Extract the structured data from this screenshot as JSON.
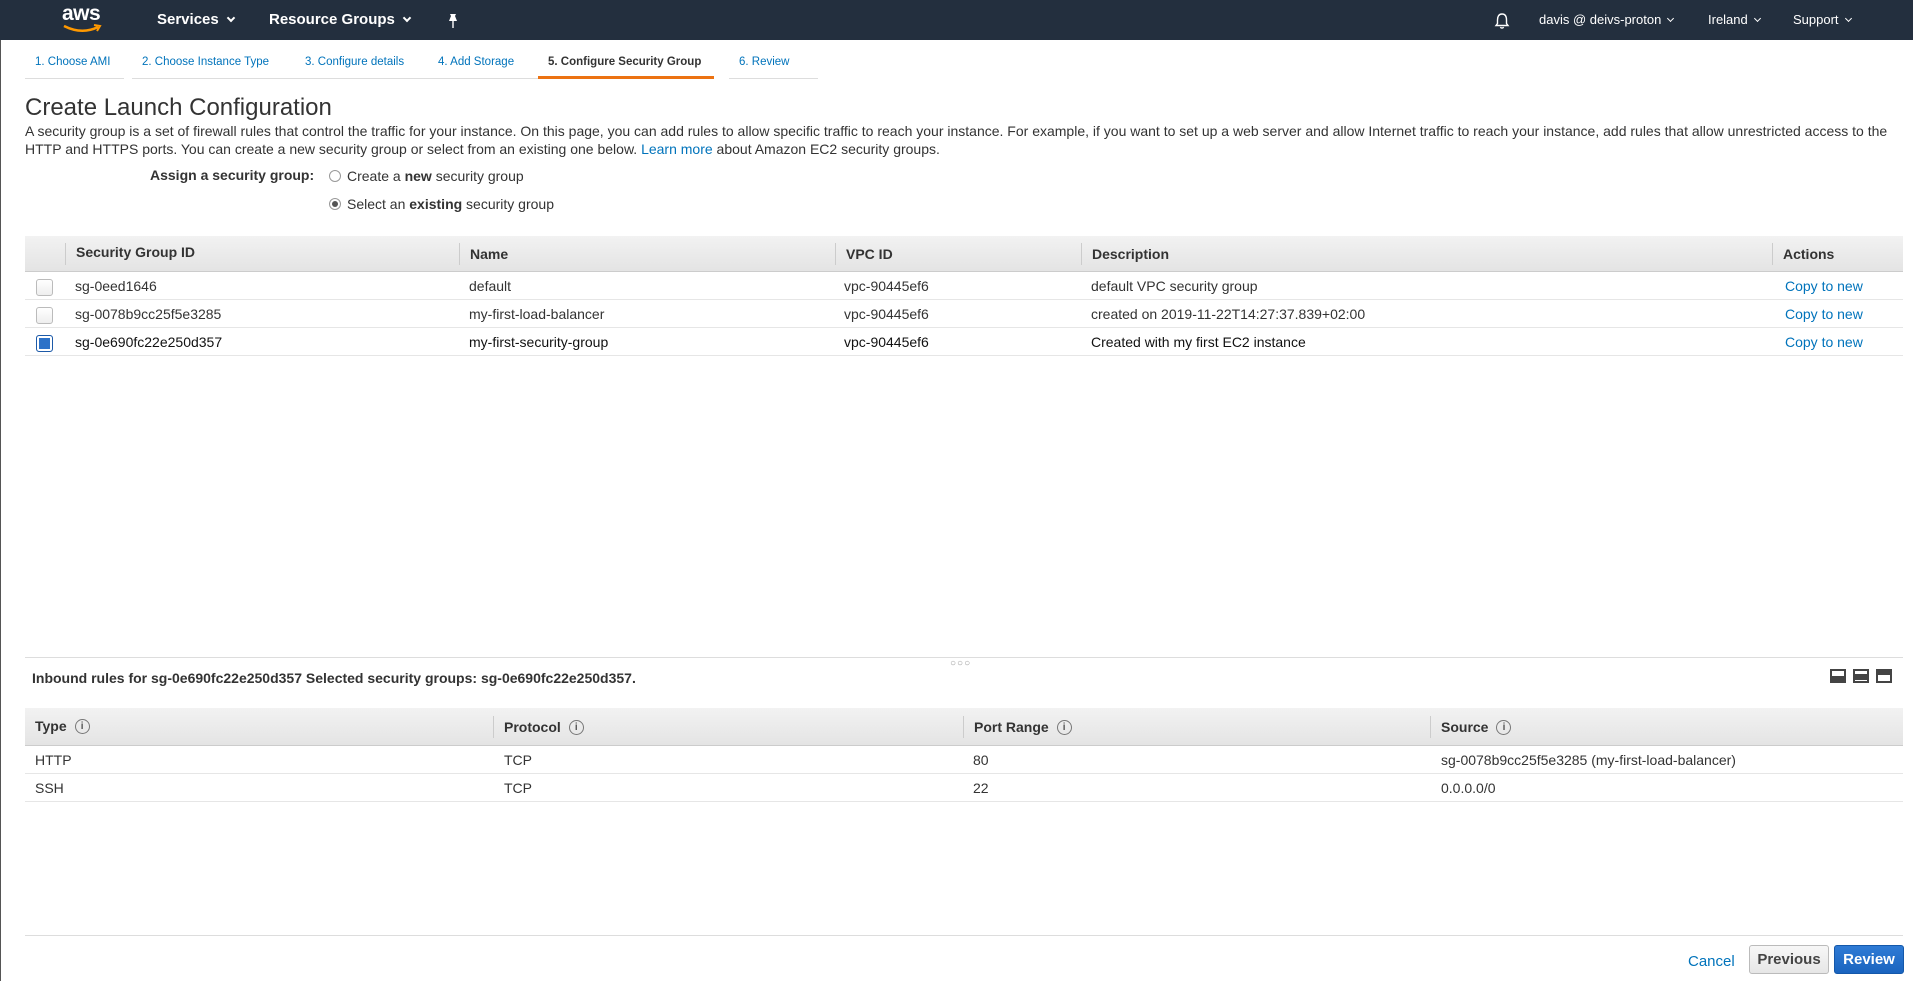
{
  "topnav": {
    "logo": "aws",
    "services": "Services",
    "resource_groups": "Resource Groups",
    "user": "davis @ deivs-proton",
    "region": "Ireland",
    "support": "Support"
  },
  "tabs": [
    {
      "label": "1. Choose AMI"
    },
    {
      "label": "2. Choose Instance Type"
    },
    {
      "label": "3. Configure details"
    },
    {
      "label": "4. Add Storage"
    },
    {
      "label": "5. Configure Security Group"
    },
    {
      "label": "6. Review"
    }
  ],
  "page": {
    "title": "Create Launch Configuration",
    "intro_text": "A security group is a set of firewall rules that control the traffic for your instance. On this page, you can add rules to allow specific traffic to reach your instance. For example, if you want to set up a web server and allow Internet traffic to reach your instance, add rules that allow unrestricted access to the HTTP and HTTPS ports. You can create a new security group or select from an existing one below.",
    "learn_more": "Learn more",
    "intro_tail": "about Amazon EC2 security groups."
  },
  "assign": {
    "label": "Assign a security group:",
    "option_new_pre": "Create a ",
    "option_new_bold": "new",
    "option_new_post": " security group",
    "option_existing_pre": "Select an ",
    "option_existing_bold": "existing",
    "option_existing_post": " security group",
    "selected": "existing"
  },
  "sg_table": {
    "headers": {
      "id": "Security Group ID",
      "name": "Name",
      "vpc": "VPC ID",
      "desc": "Description",
      "actions": "Actions"
    },
    "rows": [
      {
        "id": "sg-0eed1646",
        "name": "default",
        "vpc": "vpc-90445ef6",
        "desc": "default VPC security group",
        "action": "Copy to new",
        "checked": false
      },
      {
        "id": "sg-0078b9cc25f5e3285",
        "name": "my-first-load-balancer",
        "vpc": "vpc-90445ef6",
        "desc": "created on 2019-11-22T14:27:37.839+02:00",
        "action": "Copy to new",
        "checked": false
      },
      {
        "id": "sg-0e690fc22e250d357",
        "name": "my-first-security-group",
        "vpc": "vpc-90445ef6",
        "desc": "Created with my first EC2 instance",
        "action": "Copy to new",
        "checked": true
      }
    ]
  },
  "inbound": {
    "title": "Inbound rules for sg-0e690fc22e250d357 Selected security groups: sg-0e690fc22e250d357.",
    "headers": {
      "type": "Type",
      "protocol": "Protocol",
      "port": "Port Range",
      "source": "Source"
    },
    "rows": [
      {
        "type": "HTTP",
        "protocol": "TCP",
        "port": "80",
        "source": "sg-0078b9cc25f5e3285 (my-first-load-balancer)"
      },
      {
        "type": "SSH",
        "protocol": "TCP",
        "port": "22",
        "source": "0.0.0.0/0"
      }
    ]
  },
  "footer": {
    "cancel": "Cancel",
    "previous": "Previous",
    "review": "Review"
  },
  "colors": {
    "nav_bg": "#232f3e",
    "accent": "#ec7211",
    "link": "#0073bb",
    "primary_button": "#1a64bf"
  }
}
